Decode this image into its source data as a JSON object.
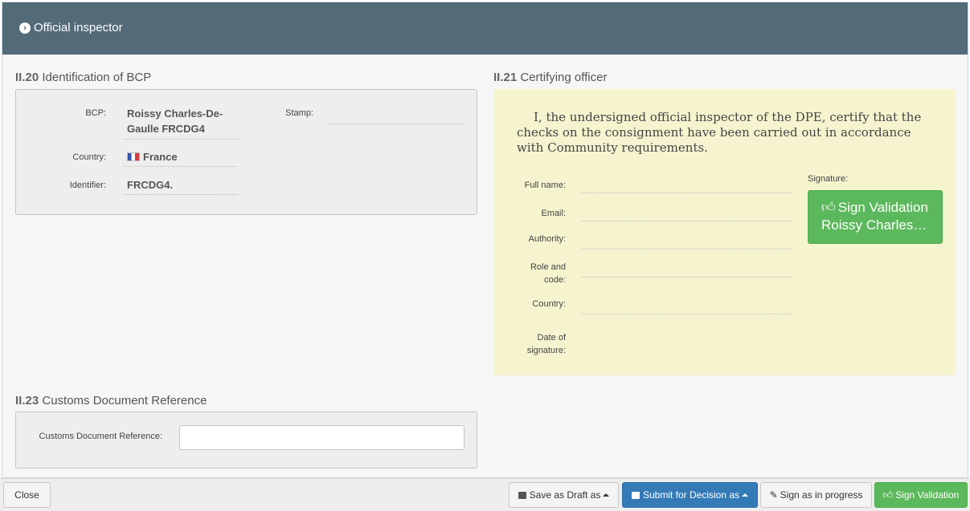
{
  "panel": {
    "title": "Official inspector",
    "icon": "chevron-circle-right-icon"
  },
  "bcp_section": {
    "code": "II.20",
    "title": "Identification of BCP",
    "bcp_label": "BCP:",
    "bcp_value_line1": "Roissy Charles-De-",
    "bcp_value_line2": "Gaulle FRCDG4",
    "stamp_label": "Stamp:",
    "country_label": "Country:",
    "country_value": "France",
    "country_flag": "flag-france-icon",
    "identifier_label": "Identifier:",
    "identifier_value": "FRCDG4."
  },
  "certifying_section": {
    "code": "II.21",
    "title": "Certifying officer",
    "statement": "I, the undersigned official inspector of the DPE, certify that the checks on the consignment have been carried out in accordance with Community requirements.",
    "full_name_label": "Full name:",
    "email_label": "Email:",
    "authority_label": "Authority:",
    "role_label_line1": "Role and",
    "role_label_line2": "code:",
    "country_label": "Country:",
    "date_label_line1": "Date of",
    "date_label_line2": "signature:",
    "signature_label": "Signature:",
    "sign_button_line1": "Sign Validation",
    "sign_button_line2": "Roissy Charles…",
    "background_color": "#f6f4cf"
  },
  "customs_section": {
    "code": "II.23",
    "title": "Customs Document Reference",
    "field_label": "Customs Document Reference:",
    "field_value": "",
    "field_placeholder": ""
  },
  "footer": {
    "close_label": "Close",
    "save_draft_label": "Save as Draft as",
    "submit_label": "Submit for Decision as",
    "sign_progress_label": "Sign as in progress",
    "sign_validation_label": "Sign Validation"
  },
  "colors": {
    "header": "#536a79",
    "primary": "#337ab7",
    "success": "#5cb85c"
  }
}
